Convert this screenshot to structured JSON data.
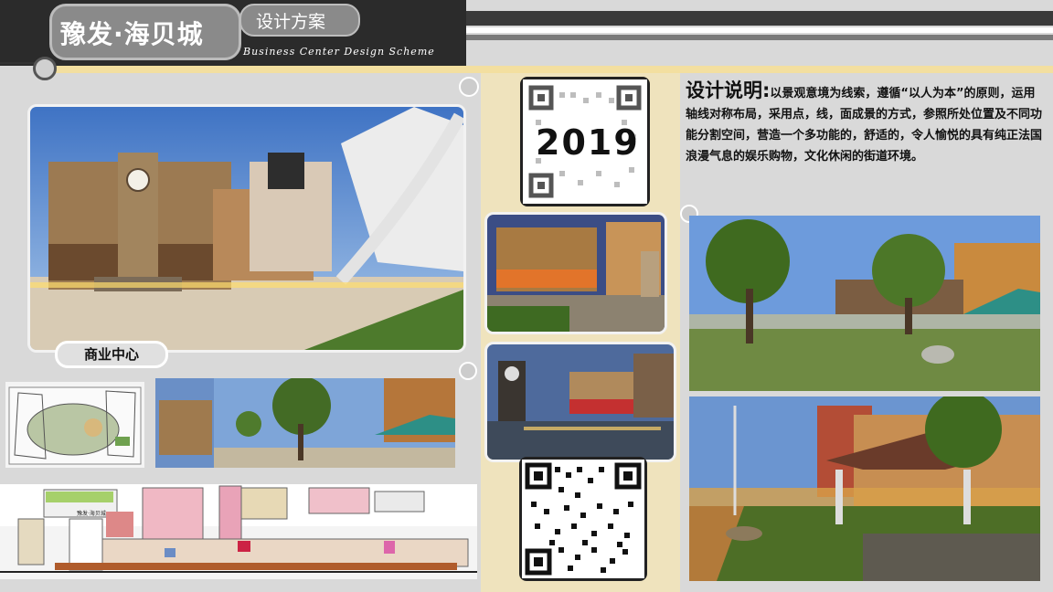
{
  "header": {
    "title": "豫发·海贝城",
    "subtitle": "设计方案",
    "english_subtitle": "Business Center Design Scheme"
  },
  "main_render": {
    "caption": "商业中心"
  },
  "qr_top": {
    "year": "2019"
  },
  "description": {
    "heading": "设计说明:",
    "body": "以景观意境为线索，遵循“以人为本”的原则，运用轴线对称布局，采用点，线，面成景的方式，参照所处位置及不同功能分割空间，营造一个多功能的，舒适的，令人愉悦的具有纯正法国浪漫气息的娱乐购物，文化休闲的街道环境。"
  },
  "elevation": {
    "sign_text": "豫发·海贝城"
  },
  "colors": {
    "header_dark": "#2b2b2b",
    "accent_gold": "#f3dfa0",
    "center_column": "#efe3bd",
    "background": "#d9d9d9"
  }
}
